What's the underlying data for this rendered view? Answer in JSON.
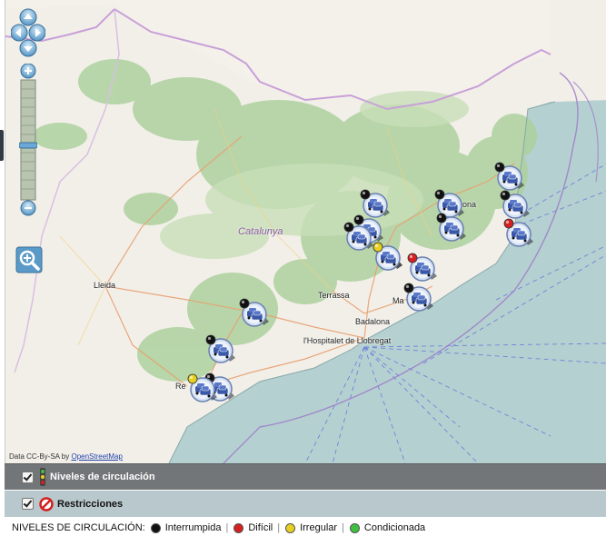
{
  "map": {
    "region_label": "Catalunya",
    "places": [
      {
        "id": "lleida",
        "label": "Lleida"
      },
      {
        "id": "terrassa",
        "label": "Terrassa"
      },
      {
        "id": "badalona",
        "label": "Badalona"
      },
      {
        "id": "hospitalet",
        "label": "l'Hospitalet de Llobregat"
      },
      {
        "id": "girona",
        "label": "rona"
      },
      {
        "id": "mataro",
        "label": "Ma"
      },
      {
        "id": "reus",
        "label": "Re"
      }
    ],
    "attribution_prefix": "Data CC-By-SA by ",
    "attribution_link": "OpenStreetMap",
    "markers": [
      {
        "status": "interrumpida"
      },
      {
        "status": "interrumpida"
      },
      {
        "status": "interrumpida"
      },
      {
        "status": "interrumpida"
      },
      {
        "status": "interrumpida"
      },
      {
        "status": "interrumpida"
      },
      {
        "status": "dificil"
      },
      {
        "status": "interrumpida"
      },
      {
        "status": "irregular"
      },
      {
        "status": "interrumpida"
      },
      {
        "status": "dificil"
      },
      {
        "status": "interrumpida"
      },
      {
        "status": "interrumpida"
      },
      {
        "status": "interrumpida"
      },
      {
        "status": "irregular"
      },
      {
        "status": "interrumpida"
      }
    ]
  },
  "layers": {
    "circulacion_label": "Niveles de circulación",
    "restricciones_label": "Restricciones"
  },
  "legend": {
    "title": "NIVELES DE CIRCULACIÓN:",
    "items": [
      {
        "label": "Interrumpida",
        "color": "#111111"
      },
      {
        "label": "Difícil",
        "color": "#d42020"
      },
      {
        "label": "Irregular",
        "color": "#e8d020"
      },
      {
        "label": "Condicionada",
        "color": "#40c040"
      }
    ]
  },
  "colors": {
    "land": "#f2efe9",
    "sea": "#b5d0d0",
    "forest": "#add19e",
    "border": "#c8a0d8",
    "coast_line": "#6677dd",
    "interrumpida": "#111111",
    "dificil": "#d42020",
    "irregular": "#e8d020",
    "condicionada": "#40c040"
  }
}
